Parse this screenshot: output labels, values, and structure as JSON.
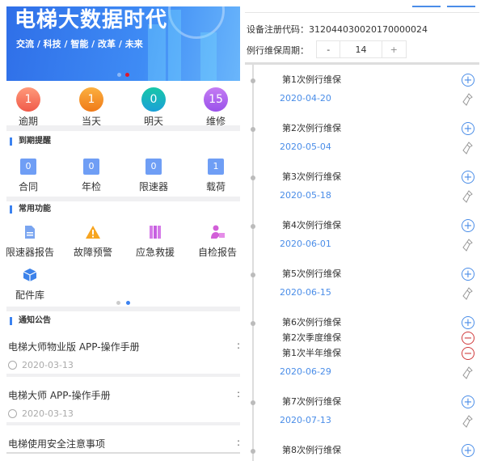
{
  "banner": {
    "title": "电梯大数据时代",
    "subtitle": "交流 / 科技 / 智能 / 改革 / 未来"
  },
  "stats": [
    {
      "label": "逾期",
      "value": "1",
      "color": "#f7745f"
    },
    {
      "label": "当天",
      "value": "1",
      "color": "#f59123"
    },
    {
      "label": "明天",
      "value": "0",
      "color": "#16b6b6"
    },
    {
      "label": "维修",
      "value": "15",
      "color": "#b063f0"
    }
  ],
  "due": {
    "title": "到期提醒",
    "items": [
      {
        "label": "合同",
        "value": "0"
      },
      {
        "label": "年检",
        "value": "0"
      },
      {
        "label": "限速器",
        "value": "0"
      },
      {
        "label": "载荷",
        "value": "1"
      }
    ]
  },
  "functions": {
    "title": "常用功能",
    "items": [
      {
        "label": "限速器报告",
        "icon": "document-icon"
      },
      {
        "label": "故障预警",
        "icon": "warning-icon"
      },
      {
        "label": "应急救援",
        "icon": "books-icon"
      },
      {
        "label": "自检报告",
        "icon": "person-report-icon"
      },
      {
        "label": "配件库",
        "icon": "box-icon"
      }
    ]
  },
  "notices": {
    "title": "通知公告",
    "items": [
      {
        "title": "电梯大师物业版 APP-操作手册",
        "date": "2020-03-13"
      },
      {
        "title": "电梯大师 APP-操作手册",
        "date": "2020-03-13"
      },
      {
        "title": "电梯使用安全注意事项"
      }
    ]
  },
  "device": {
    "code_label": "设备注册代码：",
    "code": "312044030020170000024",
    "cycle_label": "例行维保周期：",
    "cycle_value": "14",
    "minus": "-",
    "plus": "+"
  },
  "schedule": [
    {
      "items": [
        "第1次例行维保"
      ],
      "date": "2020-04-20"
    },
    {
      "items": [
        "第2次例行维保"
      ],
      "date": "2020-05-04"
    },
    {
      "items": [
        "第3次例行维保"
      ],
      "date": "2020-05-18"
    },
    {
      "items": [
        "第4次例行维保"
      ],
      "date": "2020-06-01"
    },
    {
      "items": [
        "第5次例行维保"
      ],
      "date": "2020-06-15"
    },
    {
      "items": [
        "第6次例行维保",
        "第2次季度维保",
        "第1次半年维保"
      ],
      "date": "2020-06-29"
    },
    {
      "items": [
        "第7次例行维保"
      ],
      "date": "2020-07-13"
    },
    {
      "items": [
        "第8次例行维保"
      ]
    }
  ]
}
